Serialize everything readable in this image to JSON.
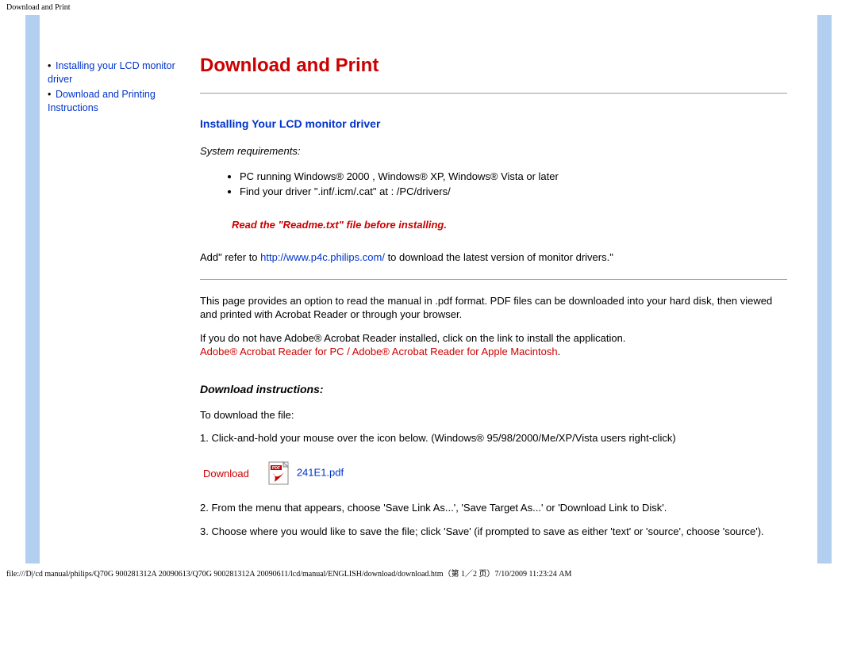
{
  "header_path": "Download and Print",
  "sidebar": {
    "items": [
      {
        "label": "Installing your LCD monitor driver"
      },
      {
        "label": "Download and Printing Instructions"
      }
    ]
  },
  "main": {
    "title": "Download and Print",
    "section1_heading": "Installing Your LCD monitor driver",
    "sys_req_label": "System requirements:",
    "sys_req_items": [
      "PC running Windows® 2000 , Windows® XP, Windows® Vista or later",
      "Find your driver \".inf/.icm/.cat\" at : /PC/drivers/"
    ],
    "readme_warning": "Read the \"Readme.txt\" file before installing.",
    "add_refer_pre": "Add\" refer to ",
    "add_refer_link": "http://www.p4c.philips.com/",
    "add_refer_post": " to download the latest version of monitor drivers.\"",
    "pdf_intro": "This page provides an option to read the manual in .pdf format. PDF files can be downloaded into your hard disk, then viewed and printed with Acrobat Reader or through your browser.",
    "acrobat_pre": "If you do not have Adobe® Acrobat Reader installed, click on the link to install the application.",
    "acrobat_pc": "Adobe® Acrobat Reader for PC",
    "acrobat_sep": " / ",
    "acrobat_mac": "Adobe® Acrobat Reader for Apple Macintosh",
    "acrobat_period": ".",
    "dl_heading": "Download instructions:",
    "dl_intro": "To download the file:",
    "dl_step1": "1. Click-and-hold your mouse over the icon below. (Windows® 95/98/2000/Me/XP/Vista users right-click)",
    "dl_label": "Download",
    "dl_file": "241E1.pdf",
    "dl_step2": "2. From the menu that appears, choose 'Save Link As...', 'Save Target As...' or 'Download Link to Disk'.",
    "dl_step3": "3. Choose where you would like to save the file; click 'Save' (if prompted to save as either 'text' or 'source', choose 'source')."
  },
  "footer_path": "file:///D|/cd manual/philips/Q70G 900281312A 20090613/Q70G 900281312A 20090611/lcd/manual/ENGLISH/download/download.htm（第 1／2 页）7/10/2009 11:23:24 AM"
}
